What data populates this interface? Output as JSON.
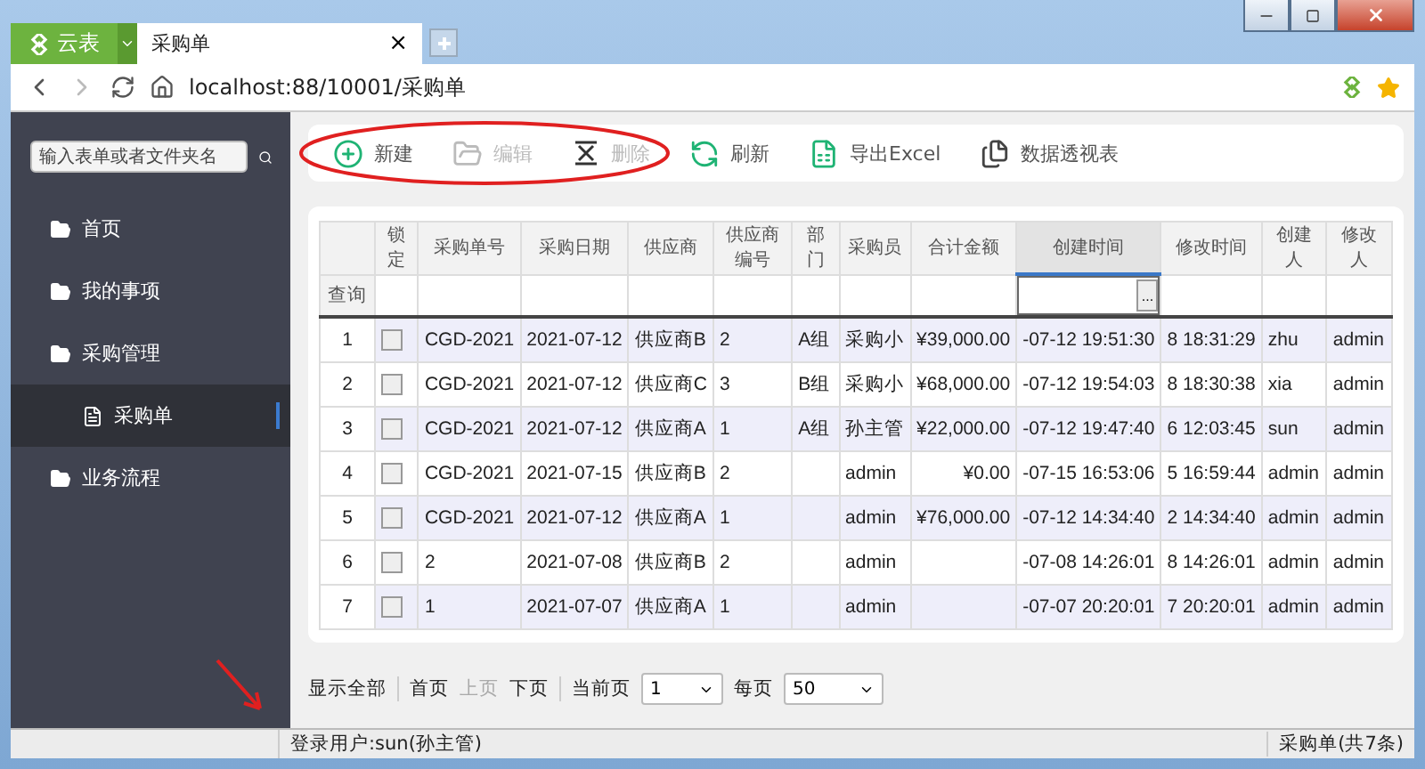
{
  "browser": {
    "app_button": "云表",
    "tab": {
      "title": "采购单",
      "close": "×"
    },
    "url": "localhost:88/10001/采购单"
  },
  "sidebar": {
    "search": {
      "placeholder": "输入表单或者文件夹名"
    },
    "items": [
      {
        "label": "首页",
        "kind": "folder",
        "selected": false
      },
      {
        "label": "我的事项",
        "kind": "folder",
        "selected": false
      },
      {
        "label": "采购管理",
        "kind": "folder",
        "selected": false,
        "children": [
          {
            "label": "采购单",
            "kind": "form",
            "selected": true
          }
        ]
      },
      {
        "label": "业务流程",
        "kind": "folder",
        "selected": false
      }
    ]
  },
  "toolbar": [
    {
      "label": "新建",
      "kind": "add",
      "disabled": false
    },
    {
      "label": "编辑",
      "kind": "edit",
      "disabled": true
    },
    {
      "label": "删除",
      "kind": "delete",
      "disabled": true
    },
    {
      "label": "刷新",
      "kind": "refresh",
      "disabled": false
    },
    {
      "label": "导出Excel",
      "kind": "excel",
      "disabled": false
    },
    {
      "label": "数据透视表",
      "kind": "pivot",
      "disabled": false
    }
  ],
  "table": {
    "filter_label": "查询",
    "columns": [
      {
        "label": "锁定",
        "selected": false
      },
      {
        "label": "采购单号",
        "selected": false
      },
      {
        "label": "采购日期",
        "selected": false
      },
      {
        "label": "供应商",
        "selected": false
      },
      {
        "label": "供应商编号",
        "selected": false
      },
      {
        "label": "部门",
        "selected": false
      },
      {
        "label": "采购员",
        "selected": false
      },
      {
        "label": "合计金额",
        "selected": false
      },
      {
        "label": "创建时间",
        "selected": true
      },
      {
        "label": "修改时间",
        "selected": false
      },
      {
        "label": "创建人",
        "selected": false
      },
      {
        "label": "修改人",
        "selected": false
      }
    ],
    "filter_button": "...",
    "rows": [
      {
        "index": "1",
        "checked": false,
        "cells": [
          "",
          "CGD-2021",
          "2021-07-12",
          "供应商B",
          "2",
          "A组",
          "采购小",
          "¥39,000.00",
          "-07-12 19:51:30",
          "8 18:31:29",
          "zhu",
          "admin"
        ]
      },
      {
        "index": "2",
        "checked": false,
        "cells": [
          "",
          "CGD-2021",
          "2021-07-12",
          "供应商C",
          "3",
          "B组",
          "采购小",
          "¥68,000.00",
          "-07-12 19:54:03",
          "8 18:30:38",
          "xia",
          "admin"
        ]
      },
      {
        "index": "3",
        "checked": false,
        "cells": [
          "",
          "CGD-2021",
          "2021-07-12",
          "供应商A",
          "1",
          "A组",
          "孙主管",
          "¥22,000.00",
          "-07-12 19:47:40",
          "6 12:03:45",
          "sun",
          "admin"
        ]
      },
      {
        "index": "4",
        "checked": false,
        "cells": [
          "",
          "CGD-2021",
          "2021-07-15",
          "供应商B",
          "2",
          "",
          "admin",
          "¥0.00",
          "-07-15 16:53:06",
          "5 16:59:44",
          "admin",
          "admin"
        ]
      },
      {
        "index": "5",
        "checked": false,
        "cells": [
          "",
          "CGD-2021",
          "2021-07-12",
          "供应商A",
          "1",
          "",
          "admin",
          "¥76,000.00",
          "-07-12 14:34:40",
          "2 14:34:40",
          "admin",
          "admin"
        ]
      },
      {
        "index": "6",
        "checked": false,
        "cells": [
          "",
          "2",
          "2021-07-08",
          "供应商B",
          "2",
          "",
          "admin",
          "",
          "-07-08 14:26:01",
          "8 14:26:01",
          "admin",
          "admin"
        ]
      },
      {
        "index": "7",
        "checked": false,
        "cells": [
          "",
          "1",
          "2021-07-07",
          "供应商A",
          "1",
          "",
          "admin",
          "",
          "-07-07 20:20:01",
          "7 20:20:01",
          "admin",
          "admin"
        ]
      }
    ]
  },
  "pagination": {
    "show_all": "显示全部",
    "links": [
      {
        "label": "首页",
        "disabled": false
      },
      {
        "label": "上页",
        "disabled": true
      },
      {
        "label": "下页",
        "disabled": false
      }
    ],
    "page_label": "当前页",
    "page": "1",
    "size_label": "每页",
    "size": "50"
  },
  "status_bar": {
    "user": "登录用户:sun(孙主管)",
    "count": "采购单(共7条)"
  }
}
